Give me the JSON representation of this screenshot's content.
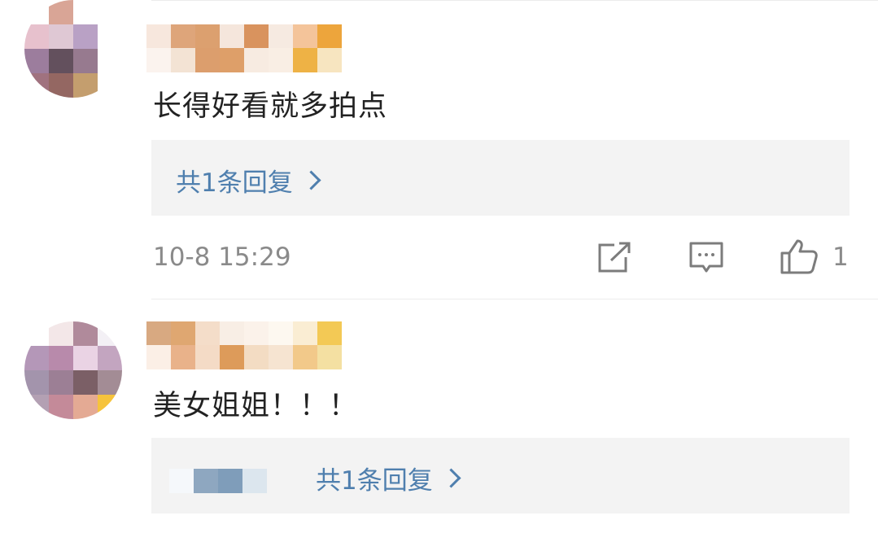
{
  "comments": [
    {
      "text": "长得好看就多拍点",
      "reply_link": "共1条回复",
      "time": "10-8 15:29",
      "like_count": "1",
      "avatar_colors": [
        "#ffffff",
        "#d9a596",
        "#ffffff",
        "#ffffff",
        "#e7c1cd",
        "#dfc8d4",
        "#b9a1c5",
        "#ffffff",
        "#9c7d9d",
        "#63505d",
        "#977a8f",
        "#ffffff",
        "#a0727f",
        "#946762",
        "#c49e6e",
        "#ffffff"
      ],
      "name_colors": [
        "#f7e7dd",
        "#dea57a",
        "#dca06f",
        "#f5e6dc",
        "#d9935e",
        "#f6eae1",
        "#f4c49a",
        "#eda53c",
        "#fbf3ee",
        "#f3e3d4",
        "#dc9e6d",
        "#de9f69",
        "#f7ebe1",
        "#f9eee4",
        "#eeb245",
        "#f7e5c0"
      ]
    },
    {
      "text": "美女姐姐！！！",
      "reply_link": "共1条回复",
      "avatar_colors": [
        "#ffffff",
        "#f3e7e8",
        "#b08a9b",
        "#f3f0f5",
        "#b497b8",
        "#b88aab",
        "#ead3e4",
        "#c3a5c0",
        "#a394ac",
        "#9c7f95",
        "#7b5f66",
        "#a38c95",
        "#b3a0b3",
        "#c48a99",
        "#e4aa94",
        "#f6c33c"
      ],
      "name_colors": [
        "#d8a981",
        "#dfa771",
        "#f4ddc9",
        "#f8eee5",
        "#fbf2ea",
        "#fdf8f0",
        "#faedd3",
        "#f3c955",
        "#fbefe6",
        "#e9b28a",
        "#f4dbc6",
        "#dd9b5a",
        "#f3dcc3",
        "#f6e4d1",
        "#f2c98a",
        "#f4e0a2"
      ],
      "reply_mosaic_colors": [
        "#f5f8fb",
        "#8ea7c0",
        "#7f9dba",
        "#dce6ee"
      ]
    }
  ]
}
